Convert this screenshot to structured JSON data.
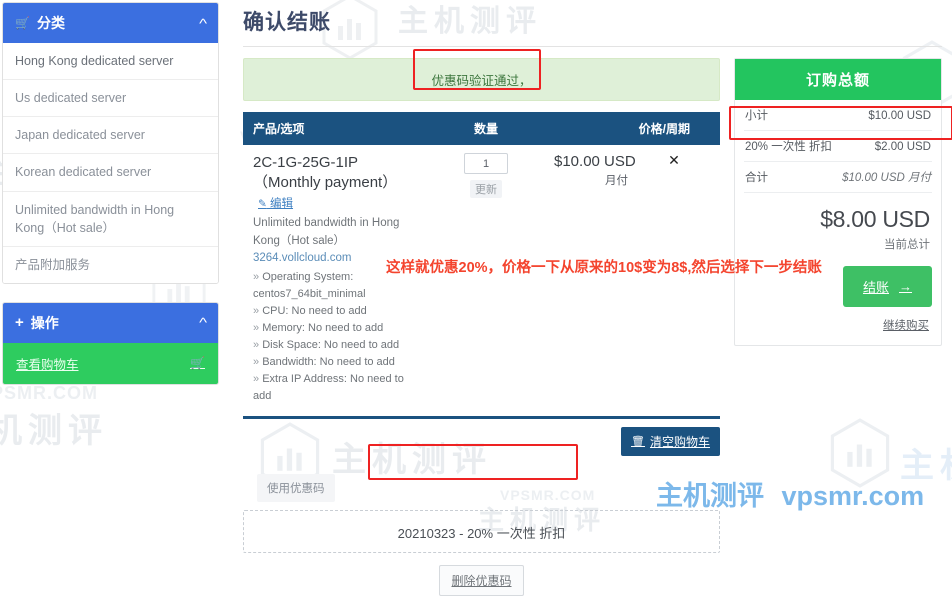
{
  "page": {
    "title": "确认结账"
  },
  "sidebar": {
    "category_panel": {
      "title": "分类",
      "cart_icon": "cart-icon",
      "collapse_icon": "chevron-up-icon",
      "items": [
        {
          "label": "Hong Kong dedicated server"
        },
        {
          "label": "Us dedicated server"
        },
        {
          "label": "Japan dedicated server"
        },
        {
          "label": "Korean dedicated server"
        },
        {
          "label": "Unlimited bandwidth in Hong Kong（Hot sale）"
        },
        {
          "label": "产品附加服务"
        }
      ]
    },
    "action_panel": {
      "title": "操作",
      "plus_icon": "plus-icon",
      "collapse_icon": "chevron-up-icon",
      "view_cart_label": "查看购物车",
      "view_cart_icon": "cart-icon"
    }
  },
  "alert": {
    "message": "优惠码验证通过，"
  },
  "cart": {
    "headers": {
      "product": "产品/选项",
      "qty": "数量",
      "price": "价格/周期"
    },
    "row": {
      "product_name": "2C-1G-25G-1IP（Monthly payment）",
      "edit_label": "编辑",
      "edit_icon": "pencil-icon",
      "group": "Unlimited bandwidth in Hong Kong（Hot sale）",
      "domain": "3264.vollcloud.com",
      "config": [
        "Operating System: centos7_64bit_minimal",
        "CPU: No need to add",
        "Memory: No need to add",
        "Disk Space: No need to add",
        "Bandwidth: No need to add",
        "Extra IP Address: No need to add"
      ],
      "qty_value": "1",
      "qty_update_label": "更新",
      "price": "$10.00 USD",
      "cycle": "月付",
      "remove_icon": "close-icon"
    },
    "empty_cart_label": "清空购物车",
    "empty_cart_icon": "trash-icon"
  },
  "promo": {
    "label": "使用优惠码",
    "applied_code": "20210323 - 20% 一次性 折扣",
    "remove_label": "删除优惠码"
  },
  "summary": {
    "title": "订购总额",
    "rows": [
      {
        "label": "小计",
        "value": "$10.00 USD"
      },
      {
        "label": "20% 一次性 折扣",
        "value": "$2.00 USD"
      },
      {
        "label": "合计",
        "value": "$10.00 USD 月付"
      }
    ],
    "grand_total": "$8.00 USD",
    "grand_caption": "当前总计",
    "checkout_label": "结账",
    "checkout_icon": "arrow-right-icon",
    "continue_label": "继续购买"
  },
  "annotation": {
    "text": "这样就优惠20%，价格一下从原来的10$变为8$,然后选择下一步结账"
  },
  "watermarks": {
    "brand_cn": "主机测评",
    "brand_en": "VPSMR.COM",
    "footer_cn": "主机测评",
    "footer_en": "vpsmr.com",
    "hex_icon": "chart-hexagon-icon"
  },
  "colors": {
    "sidebar_blue": "#3b6fe0",
    "green": "#23c55e",
    "table_navy": "#1b5280",
    "alert_bg": "#dff0d8",
    "alert_text": "#3c763d",
    "highlight_red": "#ee2222",
    "annotation_red": "#f4442e",
    "footer_blue": "#79b4e8"
  }
}
